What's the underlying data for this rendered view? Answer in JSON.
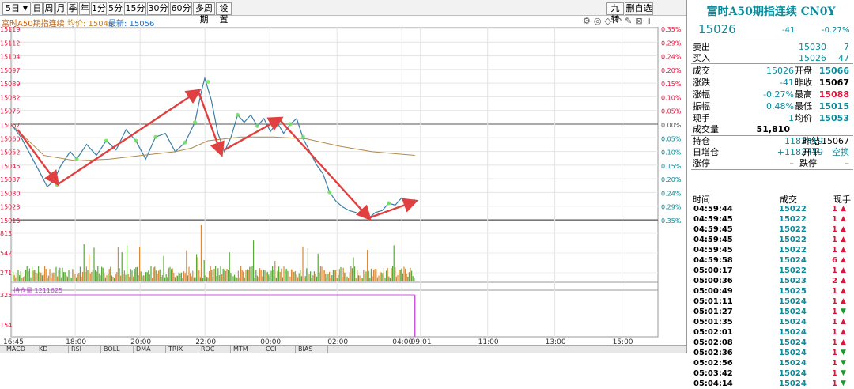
{
  "toolbar": {
    "period_select": "5日",
    "buttons": [
      "日",
      "周",
      "月",
      "季",
      "年",
      "1分",
      "5分",
      "15分",
      "30分",
      "60分",
      "多周期",
      "设置"
    ],
    "right_buttons": [
      "九转",
      "删自选"
    ]
  },
  "chart_title": {
    "name": "富时A50期指连续",
    "avg_label": "均价: 15046",
    "last_label": "最新: 15056"
  },
  "chart_data": {
    "type": "line",
    "price_axis": [
      "15119",
      "15112",
      "15104",
      "15097",
      "15089",
      "15082",
      "15075",
      "15067",
      "15060",
      "15052",
      "15045",
      "15037",
      "15030",
      "15023",
      "15015"
    ],
    "pct_axis": [
      "0.35%",
      "0.29%",
      "0.24%",
      "0.20%",
      "0.15%",
      "0.10%",
      "0.05%",
      "0.00%",
      "0.05%",
      "0.10%",
      "0.15%",
      "0.20%",
      "0.24%",
      "0.29%",
      "0.35%"
    ],
    "ylim": [
      15015,
      15119
    ],
    "prev_close": 15067,
    "volume_axis": [
      "813",
      "542",
      "271"
    ],
    "position_label": "持仓量 1211625",
    "position_axis": [
      "325",
      "154"
    ],
    "x_labels": [
      "16:45",
      "18:00",
      "20:00",
      "22:00",
      "00:00",
      "02:00",
      "04:00",
      "09:01",
      "11:00",
      "13:00",
      "15:00"
    ],
    "price_points": [
      [
        0,
        15067
      ],
      [
        3,
        15060
      ],
      [
        6,
        15050
      ],
      [
        9,
        15040
      ],
      [
        11,
        15033
      ],
      [
        13,
        15036
      ],
      [
        15,
        15044
      ],
      [
        18,
        15052
      ],
      [
        20,
        15048
      ],
      [
        23,
        15056
      ],
      [
        26,
        15050
      ],
      [
        29,
        15058
      ],
      [
        32,
        15053
      ],
      [
        35,
        15064
      ],
      [
        38,
        15058
      ],
      [
        41,
        15048
      ],
      [
        44,
        15060
      ],
      [
        47,
        15062
      ],
      [
        50,
        15052
      ],
      [
        53,
        15057
      ],
      [
        56,
        15068
      ],
      [
        58,
        15085
      ],
      [
        59,
        15092
      ],
      [
        61,
        15080
      ],
      [
        63,
        15062
      ],
      [
        65,
        15052
      ],
      [
        67,
        15060
      ],
      [
        69,
        15072
      ],
      [
        71,
        15068
      ],
      [
        73,
        15072
      ],
      [
        75,
        15066
      ],
      [
        77,
        15070
      ],
      [
        79,
        15063
      ],
      [
        81,
        15068
      ],
      [
        83,
        15062
      ],
      [
        85,
        15067
      ],
      [
        87,
        15070
      ],
      [
        89,
        15059
      ],
      [
        91,
        15052
      ],
      [
        93,
        15045
      ],
      [
        95,
        15040
      ],
      [
        97,
        15030
      ],
      [
        99,
        15025
      ],
      [
        101,
        15022
      ],
      [
        103,
        15020
      ],
      [
        105,
        15019
      ],
      [
        107,
        15017
      ],
      [
        109,
        15016
      ],
      [
        111,
        15019
      ],
      [
        113,
        15020
      ],
      [
        115,
        15024
      ],
      [
        117,
        15023
      ],
      [
        119,
        15027
      ],
      [
        121,
        15024
      ],
      [
        123,
        15026
      ]
    ],
    "avg_points": [
      [
        0,
        15067
      ],
      [
        10,
        15050
      ],
      [
        20,
        15047
      ],
      [
        30,
        15048
      ],
      [
        40,
        15050
      ],
      [
        50,
        15052
      ],
      [
        55,
        15054
      ],
      [
        60,
        15058
      ],
      [
        70,
        15060
      ],
      [
        80,
        15060
      ],
      [
        90,
        15059
      ],
      [
        100,
        15055
      ],
      [
        110,
        15052
      ],
      [
        123,
        15050
      ]
    ],
    "arrows": [
      [
        [
          2,
          15064
        ],
        [
          14,
          15035
        ]
      ],
      [
        [
          14,
          15034
        ],
        [
          57,
          15085
        ]
      ],
      [
        [
          57,
          15085
        ],
        [
          64,
          15051
        ]
      ],
      [
        [
          65,
          15053
        ],
        [
          82,
          15070
        ]
      ],
      [
        [
          82,
          15069
        ],
        [
          109,
          15016
        ]
      ],
      [
        [
          109,
          15016
        ],
        [
          123,
          15025
        ]
      ]
    ],
    "x_domain": [
      0,
      197
    ]
  },
  "bottom_tabs": [
    "MACD",
    "KD",
    "RSI",
    "BOLL",
    "DMA",
    "TRIX",
    "ROC",
    "MTM",
    "CCI",
    "BIAS"
  ],
  "quote": {
    "title": "富时A50期指连续 CN0Y",
    "price": "15026",
    "change": "-41",
    "pct": "-0.27%",
    "sell_label": "卖出",
    "sell_price": "15030",
    "sell_vol": "7",
    "buy_label": "买入",
    "buy_price": "15026",
    "buy_vol": "47",
    "rows": [
      {
        "l1": "成交",
        "v1": "15026",
        "l2": "开盘",
        "v2": "15066",
        "c2": "teal"
      },
      {
        "l1": "涨跌",
        "v1": "-41",
        "l2": "昨收",
        "v2": "15067",
        "c2": "black"
      },
      {
        "l1": "涨幅",
        "v1": "-0.27%",
        "l2": "最高",
        "v2": "15088",
        "c2": "red"
      },
      {
        "l1": "振幅",
        "v1": "0.48%",
        "l2": "最低",
        "v2": "15015",
        "c2": "teal"
      },
      {
        "l1": "现手",
        "v1": "1",
        "l2": "均价",
        "v2": "15053",
        "c2": "teal"
      }
    ],
    "volume_label": "成交量",
    "volume": "51,810",
    "oi_label": "持仓",
    "oi": "1182419",
    "settle_label": "昨结",
    "settle": "15067",
    "oi_add_label": "日增仓",
    "oi_add": "+1182419",
    "open_type_label": "开平",
    "open_type": "空换",
    "limit_up_label": "涨停",
    "limit_up": "–",
    "limit_down_label": "跌停",
    "limit_down": "–"
  },
  "trades_header": {
    "time": "时间",
    "price": "成交",
    "vol": "现手"
  },
  "trades": [
    {
      "time": "04:59:44",
      "price": "15022",
      "vol": "1",
      "dir": "up"
    },
    {
      "time": "04:59:45",
      "price": "15022",
      "vol": "1",
      "dir": "up"
    },
    {
      "time": "04:59:45",
      "price": "15022",
      "vol": "1",
      "dir": "up"
    },
    {
      "time": "04:59:45",
      "price": "15022",
      "vol": "1",
      "dir": "up"
    },
    {
      "time": "04:59:45",
      "price": "15022",
      "vol": "1",
      "dir": "up"
    },
    {
      "time": "04:59:58",
      "price": "15024",
      "vol": "6",
      "dir": "up"
    },
    {
      "time": "05:00:17",
      "price": "15022",
      "vol": "1",
      "dir": "up"
    },
    {
      "time": "05:00:36",
      "price": "15023",
      "vol": "2",
      "dir": "up"
    },
    {
      "time": "05:00:49",
      "price": "15025",
      "vol": "1",
      "dir": "up"
    },
    {
      "time": "05:01:11",
      "price": "15024",
      "vol": "1",
      "dir": "up"
    },
    {
      "time": "05:01:27",
      "price": "15024",
      "vol": "1",
      "dir": "down"
    },
    {
      "time": "05:01:35",
      "price": "15024",
      "vol": "1",
      "dir": "up"
    },
    {
      "time": "05:02:01",
      "price": "15024",
      "vol": "1",
      "dir": "up"
    },
    {
      "time": "05:02:08",
      "price": "15024",
      "vol": "1",
      "dir": "up"
    },
    {
      "time": "05:02:36",
      "price": "15024",
      "vol": "1",
      "dir": "down"
    },
    {
      "time": "05:02:56",
      "price": "15024",
      "vol": "1",
      "dir": "down"
    },
    {
      "time": "05:03:42",
      "price": "15024",
      "vol": "1",
      "dir": "down"
    },
    {
      "time": "05:04:14",
      "price": "15024",
      "vol": "1",
      "dir": "down"
    }
  ]
}
